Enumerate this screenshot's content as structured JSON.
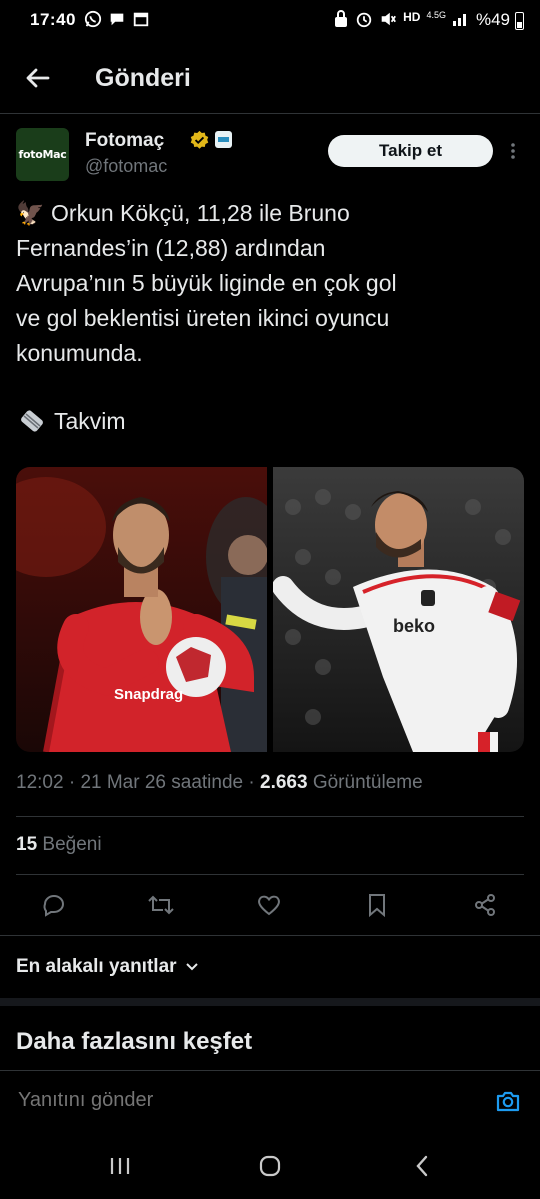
{
  "status_bar": {
    "time": "17:40",
    "network": "4.5G",
    "battery": "%49"
  },
  "header": {
    "title": "Gönderi"
  },
  "author": {
    "avatar_text": "fotoMac",
    "name": "Fotomaç",
    "handle": "@fotomac",
    "follow_label": "Takip et"
  },
  "tweet": {
    "lines": [
      "🦅 Orkun Kökçü, 11,28 ile Bruno",
      "Fernandes’in (12,88) ardından",
      "Avrupa’nın 5 büyük liginde en çok gol",
      "ve gol beklentisi üreten ikinci oyuncu",
      "konumunda."
    ],
    "source": "Takvim",
    "time": "12:02",
    "date": "21 Mar 26 saatinde",
    "views_count": "2.663",
    "views_label": "Görüntüleme",
    "likes_count": "15",
    "likes_label": "Beğeni"
  },
  "media": {
    "left_shirt_text": "Snapdrag",
    "right_shirt_text": "beko"
  },
  "replies": {
    "sort_label": "En alakalı yanıtlar",
    "discover_title": "Daha fazlasını keşfet",
    "reply_placeholder": "Yanıtını gönder"
  },
  "colors": {
    "background": "#000000",
    "text": "#e7e9ea",
    "muted": "#71767b",
    "accent": "#1d9bf0",
    "verified": "#e2b719"
  }
}
